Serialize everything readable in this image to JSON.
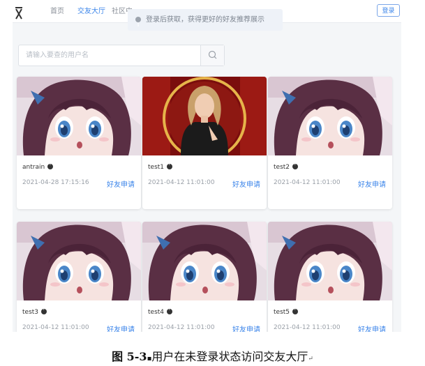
{
  "header": {
    "nav": [
      "首页",
      "交友大厅",
      "社区中"
    ],
    "login_label": "登录"
  },
  "notice": {
    "icon": "info-circle-icon",
    "text": "登录后获取，获得更好的好友推荐展示"
  },
  "search": {
    "placeholder": "请输入要查的用户名",
    "icon": "search-icon"
  },
  "users": [
    {
      "name": "antrain",
      "time": "2021-04-28 17:15:16",
      "action": "好友申请",
      "avatar": "anime-girl-avatar"
    },
    {
      "name": "test1",
      "time": "2021-04-12 11:01:00",
      "action": "好友申请",
      "avatar": "woman-photo-avatar"
    },
    {
      "name": "test2",
      "time": "2021-04-12 11:01:00",
      "action": "好友申请",
      "avatar": "anime-girl-avatar"
    },
    {
      "name": "test3",
      "time": "2021-04-12 11:01:00",
      "action": "好友申请",
      "avatar": "anime-girl-avatar"
    },
    {
      "name": "test4",
      "time": "2021-04-12 11:01:00",
      "action": "好友申请",
      "avatar": "anime-girl-avatar"
    },
    {
      "name": "test5",
      "time": "2021-04-12 11:01:00",
      "action": "好友申请",
      "avatar": "anime-girl-avatar"
    }
  ],
  "caption": {
    "label": "图 5-3",
    "text": "用户在未登录状态访问交友大厅"
  },
  "colors": {
    "accent": "#3d86ea",
    "background": "#f4f6f8"
  }
}
